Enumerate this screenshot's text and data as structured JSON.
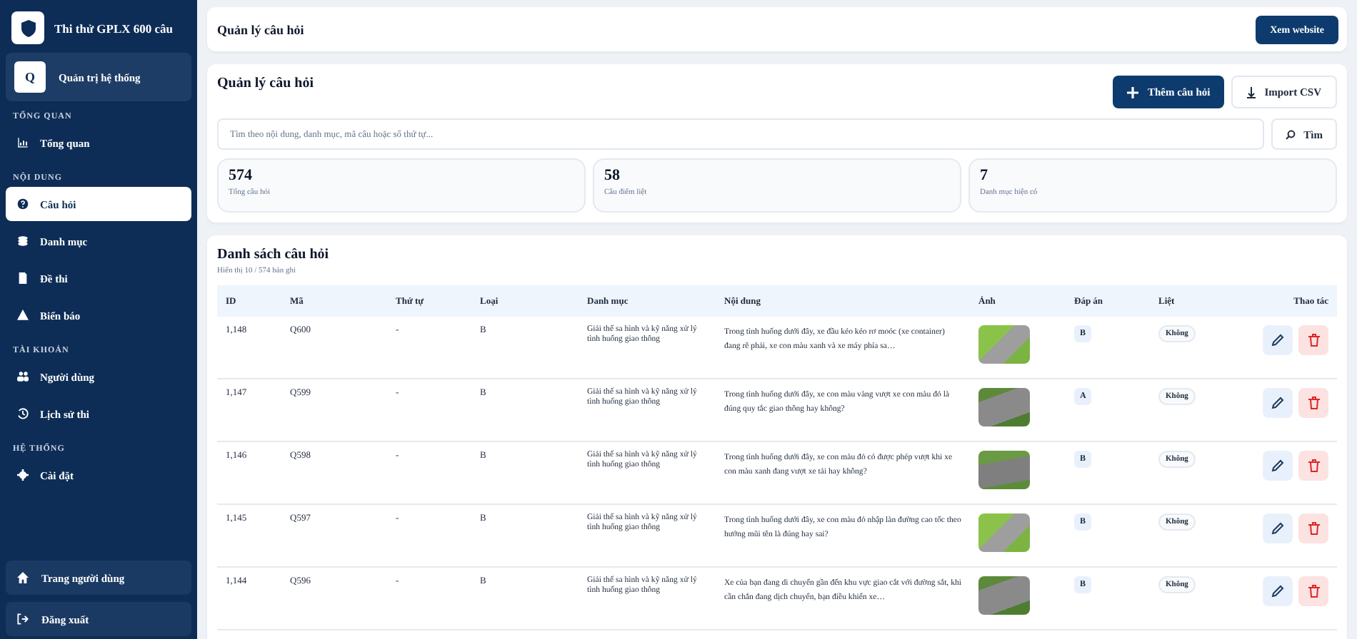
{
  "brand": {
    "title": "Thi thử GPLX 600 câu"
  },
  "account": {
    "initial": "Q",
    "label": "Quản trị hệ thống"
  },
  "sidebar": {
    "sections": [
      {
        "heading": "TỔNG QUAN",
        "items": [
          {
            "label": "Tổng quan",
            "selected": false
          }
        ]
      },
      {
        "heading": "NỘI DUNG",
        "items": [
          {
            "label": "Câu hỏi",
            "selected": true
          },
          {
            "label": "Danh mục",
            "selected": false
          },
          {
            "label": "Đề thi",
            "selected": false
          },
          {
            "label": "Biển báo",
            "selected": false
          }
        ]
      },
      {
        "heading": "TÀI KHOẢN",
        "items": [
          {
            "label": "Người dùng",
            "selected": false
          },
          {
            "label": "Lịch sử thi",
            "selected": false
          }
        ]
      },
      {
        "heading": "HỆ THỐNG",
        "items": [
          {
            "label": "Cài đặt",
            "selected": false
          }
        ]
      }
    ],
    "footer": [
      {
        "label": "Trang người dùng"
      },
      {
        "label": "Đăng xuất"
      }
    ]
  },
  "topbar": {
    "title": "Quản lý câu hỏi",
    "button": "Xem website"
  },
  "manager": {
    "title": "Quản lý câu hỏi",
    "add_button": "Thêm câu hỏi",
    "import_button": "Import CSV",
    "search": {
      "placeholder": "Tìm theo nội dung, danh mục, mã câu hoặc số thứ tự..."
    },
    "search_button": "Tìm",
    "stats": [
      {
        "value": "574",
        "label": "Tổng câu hỏi"
      },
      {
        "value": "58",
        "label": "Câu điểm liệt"
      },
      {
        "value": "7",
        "label": "Danh mục hiện có"
      }
    ]
  },
  "table": {
    "title": "Danh sách câu hỏi",
    "subtitle": "Hiển thị 10 / 574 bản ghi",
    "columns": [
      "ID",
      "Mã",
      "Thứ tự",
      "Loại",
      "Danh mục",
      "Nội dung",
      "Ảnh",
      "Đáp án",
      "Liệt",
      "Thao tác"
    ],
    "rows": [
      {
        "id": "1,148",
        "code": "Q600",
        "order": "-",
        "type": "B",
        "category": "Giải thế sa hình và kỹ năng xử lý tình huống giao thông",
        "content": "Trong tình huống dưới đây, xe đầu kéo kéo rơ moóc (xe container) đang rẽ phải, xe con màu xanh và xe máy phía sa…",
        "answer": "B",
        "fatal": "Không"
      },
      {
        "id": "1,147",
        "code": "Q599",
        "order": "-",
        "type": "B",
        "category": "Giải thế sa hình và kỹ năng xử lý tình huống giao thông",
        "content": "Trong tình huống dưới đây, xe con màu vàng vượt xe con màu đỏ là đúng quy tắc giao thông hay không?",
        "answer": "A",
        "fatal": "Không"
      },
      {
        "id": "1,146",
        "code": "Q598",
        "order": "-",
        "type": "B",
        "category": "Giải thế sa hình và kỹ năng xử lý tình huống giao thông",
        "content": "Trong tình huống dưới đây, xe con màu đỏ có được phép vượt khi xe con màu xanh đang vượt xe tải hay không?",
        "answer": "B",
        "fatal": "Không"
      },
      {
        "id": "1,145",
        "code": "Q597",
        "order": "-",
        "type": "B",
        "category": "Giải thế sa hình và kỹ năng xử lý tình huống giao thông",
        "content": "Trong tình huống dưới đây, xe con màu đỏ nhập làn đường cao tốc theo hướng mũi tên là đúng hay sai?",
        "answer": "B",
        "fatal": "Không"
      },
      {
        "id": "1,144",
        "code": "Q596",
        "order": "-",
        "type": "B",
        "category": "Giải thế sa hình và kỹ năng xử lý tình huống giao thông",
        "content": "Xe của bạn đang di chuyển gần đến khu vực giao cắt với đường sắt, khi cần chắn đang dịch chuyển, bạn điều khiển xe…",
        "answer": "B",
        "fatal": "Không"
      }
    ]
  }
}
